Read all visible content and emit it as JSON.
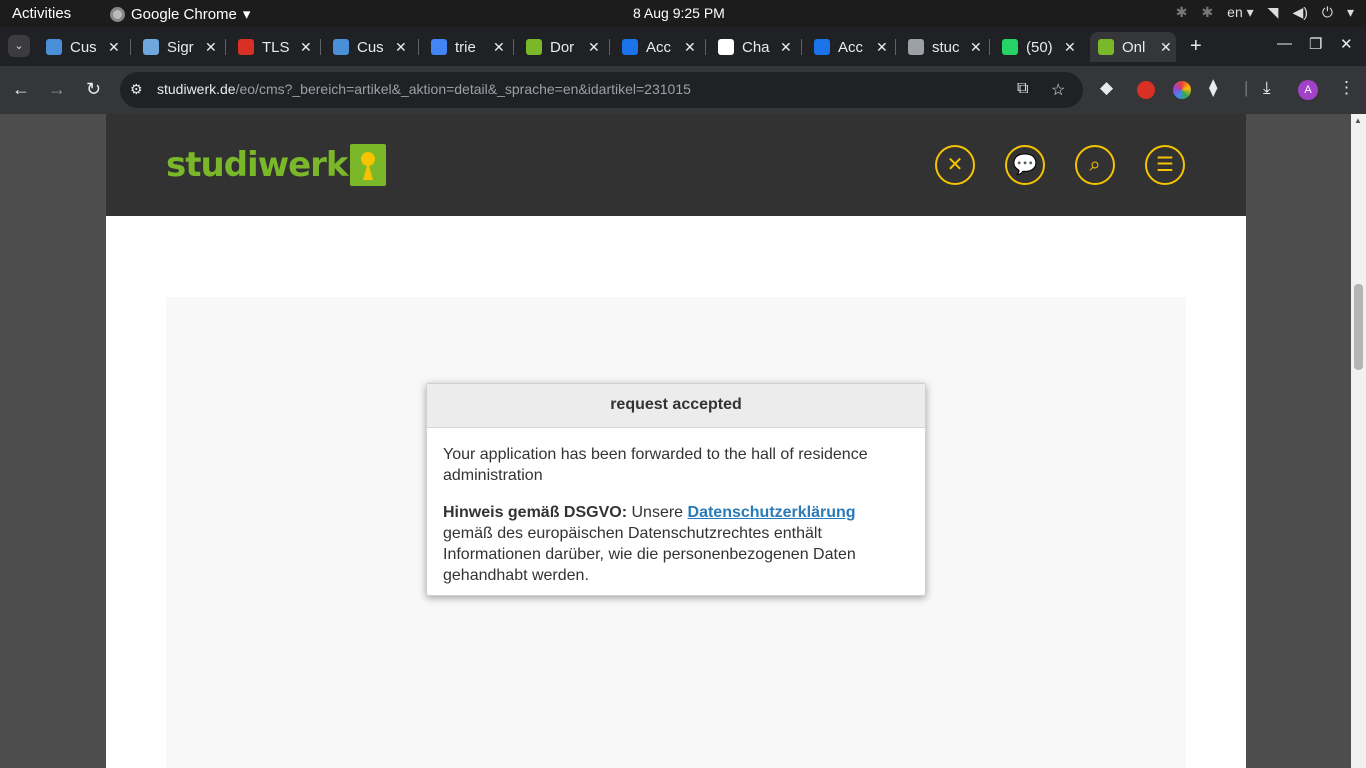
{
  "system": {
    "activities": "Activities",
    "app_name": "Google Chrome",
    "clock": "8 Aug   9:25 PM",
    "language": "en"
  },
  "tabs": [
    {
      "title": "Cus",
      "favicon_color": "#4a90d9"
    },
    {
      "title": "Sigr",
      "favicon_color": "#6fa8dc"
    },
    {
      "title": "TLS",
      "favicon_color": "#d93025"
    },
    {
      "title": "Cus",
      "favicon_color": "#4a90d9"
    },
    {
      "title": "trie",
      "favicon_color": "#4285f4"
    },
    {
      "title": "Dor",
      "favicon_color": "#7ab829"
    },
    {
      "title": "Acc",
      "favicon_color": "#1a73e8"
    },
    {
      "title": "Cha",
      "favicon_color": "#ffffff"
    },
    {
      "title": "Acc",
      "favicon_color": "#1a73e8"
    },
    {
      "title": "stuc",
      "favicon_color": "#9aa0a6"
    },
    {
      "title": "(50)",
      "favicon_color": "#25d366"
    },
    {
      "title": "Onl",
      "favicon_color": "#7ab829"
    }
  ],
  "address_bar": {
    "host": "studiwerk.de",
    "path": "/eo/cms?_bereich=artikel&_aktion=detail&_sprache=en&idartikel=231015"
  },
  "profile_initial": "A",
  "site": {
    "logo_text": "studiwerk",
    "brand_green": "#7ab829",
    "brand_yellow": "#f5c400",
    "header_icons": [
      "cutlery-icon",
      "chat-icon",
      "search-icon",
      "menu-icon"
    ]
  },
  "dialog": {
    "title": "request accepted",
    "message": "Your application has been forwarded to the hall of residence administration",
    "notice_label": "Hinweis gemäß DSGVO:",
    "notice_prefix": " Unsere ",
    "notice_link": "Datenschutzerklärung",
    "notice_suffix": " gemäß des europäischen Datenschutzrechtes enthält Informationen darüber, wie die personenbezogenen Daten gehandhabt werden."
  }
}
